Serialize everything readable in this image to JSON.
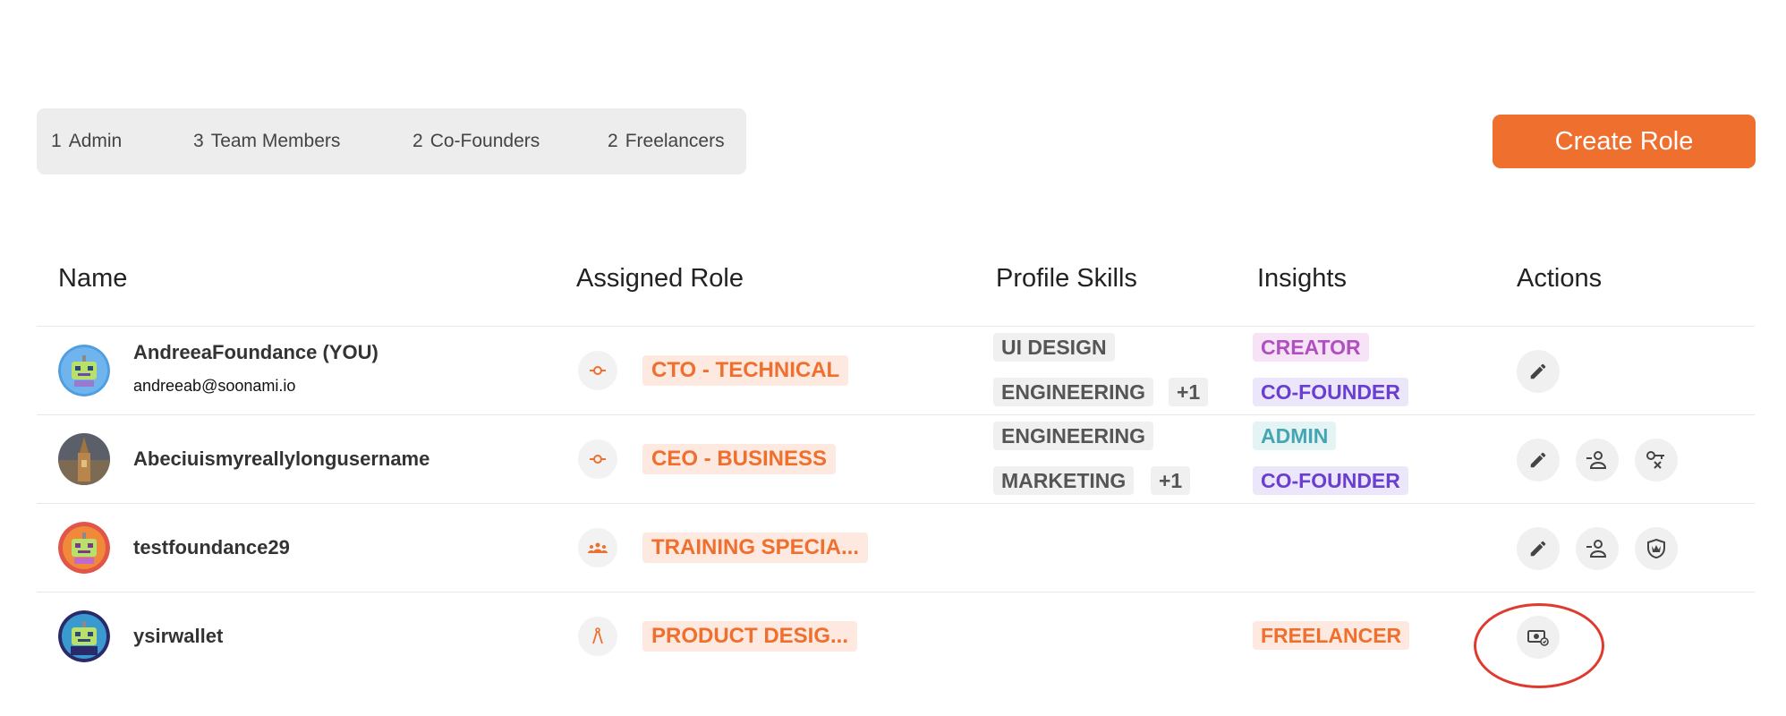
{
  "summary": {
    "items": [
      {
        "count": "1",
        "label": "Admin"
      },
      {
        "count": "3",
        "label": "Team Members"
      },
      {
        "count": "2",
        "label": "Co-Founders"
      },
      {
        "count": "2",
        "label": "Freelancers"
      }
    ]
  },
  "create_role_label": "Create Role",
  "table": {
    "headers": [
      "Name",
      "Assigned Role",
      "Profile Skills",
      "Insights",
      "Actions"
    ],
    "rows": [
      {
        "name": "AndreeaFoundance (YOU)",
        "email": "andreeab@soonami.io",
        "role": "CTO - TECHNICAL",
        "role_icon": "commit-icon",
        "skills": [
          "UI DESIGN",
          "ENGINEERING"
        ],
        "skills_more": "+1",
        "insights": [
          "CREATOR",
          "CO-FOUNDER"
        ],
        "actions": [
          "edit-icon"
        ]
      },
      {
        "name": "Abeciuismyreallylongusername",
        "role": "CEO - BUSINESS",
        "role_icon": "commit-icon",
        "skills": [
          "ENGINEERING",
          "MARKETING"
        ],
        "skills_more": "+1",
        "insights": [
          "ADMIN",
          "CO-FOUNDER"
        ],
        "actions": [
          "edit-icon",
          "remove-user-icon",
          "revoke-key-icon"
        ]
      },
      {
        "name": "testfoundance29",
        "role": "TRAINING SPECIA...",
        "role_icon": "team-icon",
        "skills": [],
        "insights": [],
        "actions": [
          "edit-icon",
          "remove-user-icon",
          "shield-icon"
        ]
      },
      {
        "name": "ysirwallet",
        "role": "PRODUCT DESIG...",
        "role_icon": "compass-icon",
        "skills": [],
        "insights": [
          "FREELANCER"
        ],
        "actions": [
          "payment-icon"
        ]
      }
    ]
  },
  "colors": {
    "accent": "#ef6f2e",
    "creator": "#b04fc0",
    "co_founder": "#6a3fd0",
    "admin": "#45a6b3",
    "freelancer": "#ef6f2e",
    "annotation": "#e03a2e"
  }
}
